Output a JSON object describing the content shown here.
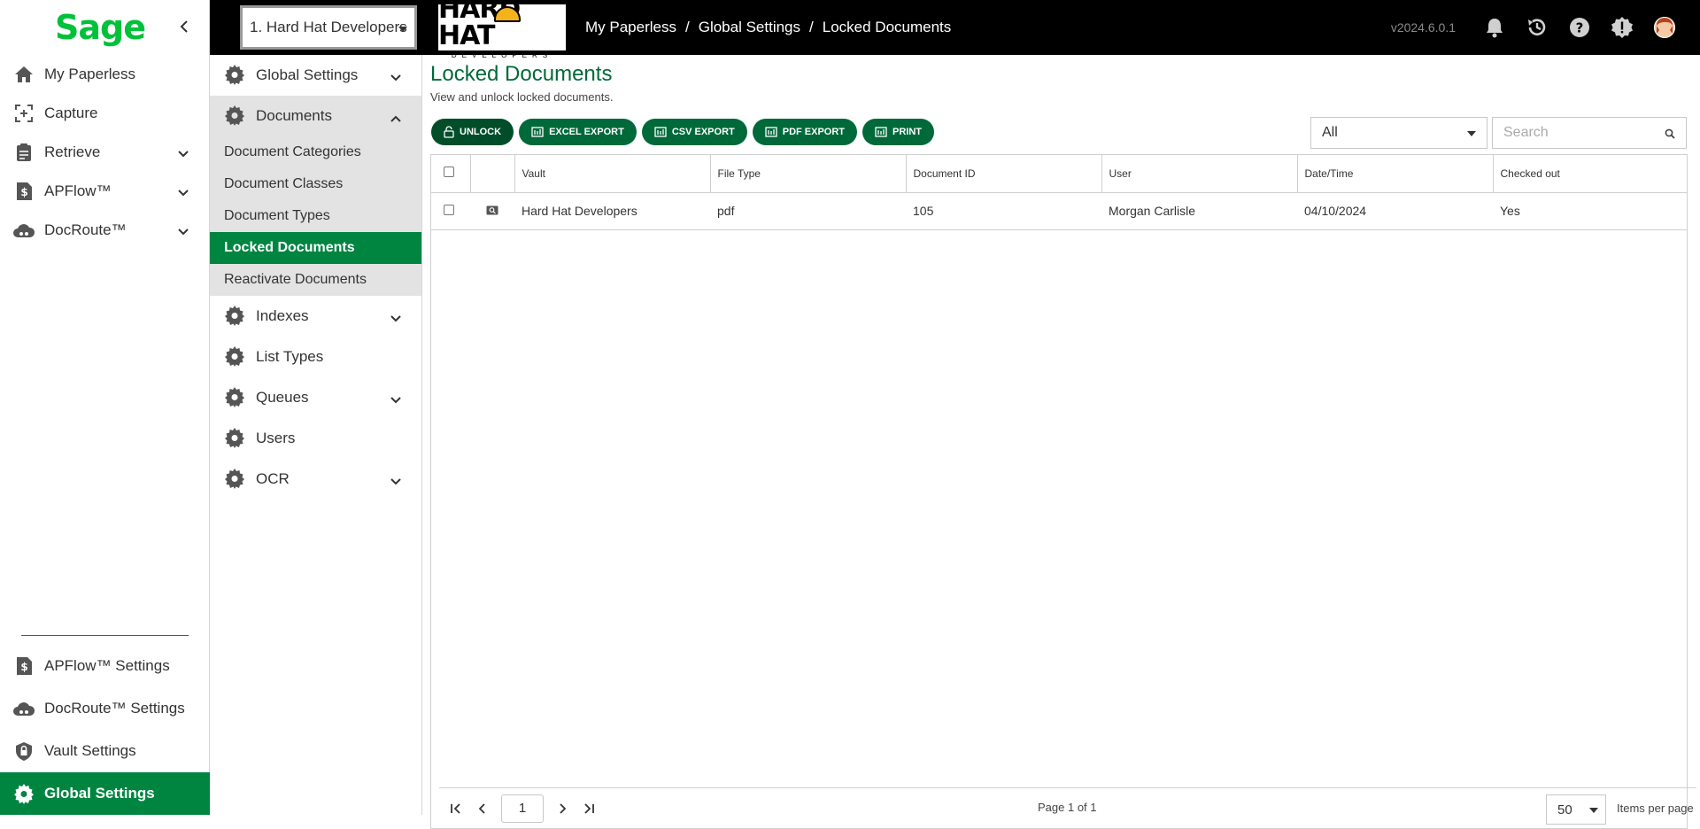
{
  "brand": {
    "logo_text": "Sage",
    "accent": "#00c13a",
    "active_green": "#008541"
  },
  "leftnav": {
    "items": [
      {
        "label": "My Paperless",
        "icon": "home-icon"
      },
      {
        "label": "Capture",
        "icon": "capture-icon"
      },
      {
        "label": "Retrieve",
        "icon": "clipboard-icon"
      },
      {
        "label": "APFlow™",
        "icon": "dollar-doc-icon"
      },
      {
        "label": "DocRoute™",
        "icon": "cloud-icon"
      }
    ],
    "bottom_items": [
      {
        "label": "APFlow™ Settings",
        "icon": "dollar-doc-icon"
      },
      {
        "label": "DocRoute™ Settings",
        "icon": "cloud-icon"
      },
      {
        "label": "Vault Settings",
        "icon": "shield-lock-icon"
      },
      {
        "label": "Global Settings",
        "icon": "gear-icon"
      }
    ]
  },
  "topbar": {
    "vault_selected": "1. Hard Hat Developers",
    "company_logo": {
      "main": "HARD HAT",
      "sub": "DEVELOPERS"
    },
    "breadcrumb": [
      "My Paperless",
      "Global Settings",
      "Locked Documents"
    ],
    "breadcrumb_sep": "/",
    "version": "v2024.6.0.1"
  },
  "submenu": {
    "global_settings": "Global Settings",
    "documents": "Documents",
    "documents_children": [
      "Document Categories",
      "Document Classes",
      "Document Types",
      "Locked Documents",
      "Reactivate Documents"
    ],
    "indexes": "Indexes",
    "list_types": "List Types",
    "queues": "Queues",
    "users": "Users",
    "ocr": "OCR"
  },
  "page": {
    "title": "Locked Documents",
    "subtitle": "View and unlock locked documents."
  },
  "toolbar": {
    "unlock": "UNLOCK",
    "excel_export": "EXCEL EXPORT",
    "csv_export": "CSV EXPORT",
    "pdf_export": "PDF EXPORT",
    "print": "PRINT"
  },
  "filter": {
    "selected": "All"
  },
  "search": {
    "placeholder": "Search"
  },
  "table": {
    "columns": [
      "Vault",
      "File Type",
      "Document ID",
      "User",
      "Date/Time",
      "Checked out"
    ],
    "rows": [
      {
        "vault": "Hard Hat Developers",
        "file_type": "pdf",
        "document_id": "105",
        "user": "Morgan Carlisle",
        "datetime": "04/10/2024",
        "checked_out": "Yes"
      }
    ]
  },
  "pager": {
    "current_page": "1",
    "page_info": "Page 1 of 1",
    "per_page": "50",
    "per_page_label": "Items per page"
  }
}
